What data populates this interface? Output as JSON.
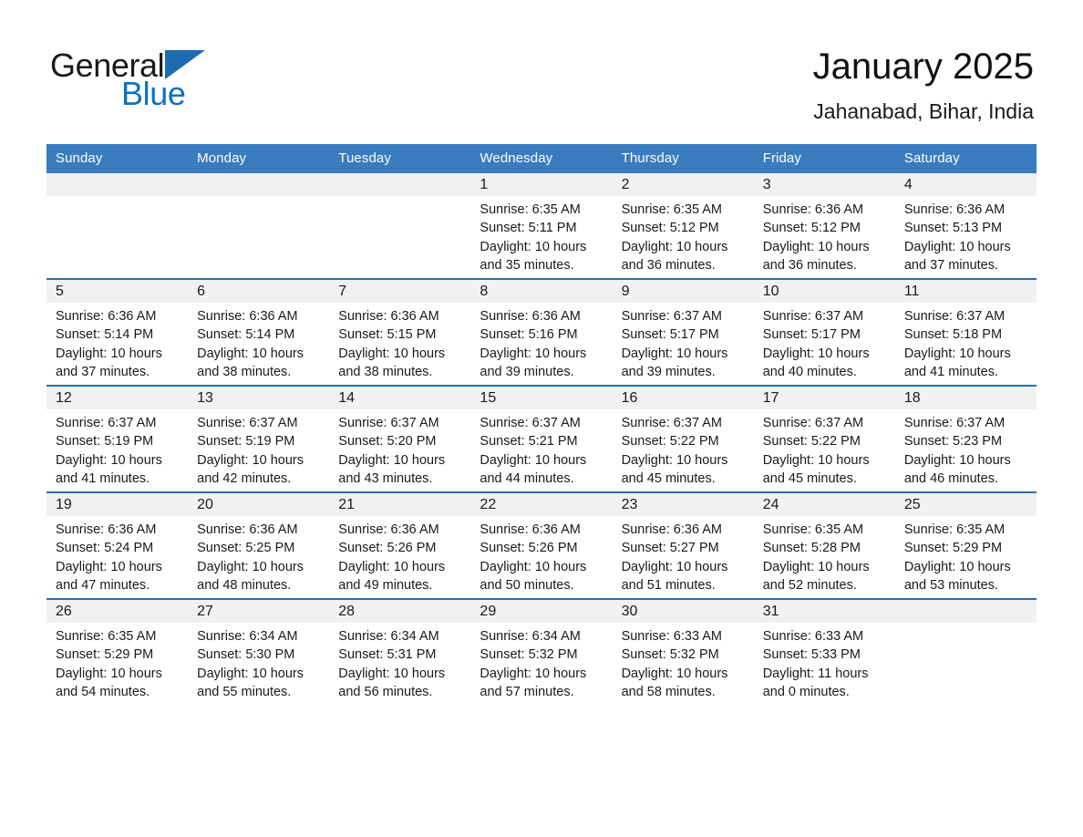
{
  "brand": {
    "name_part1": "General",
    "name_part2": "Blue",
    "triangle_color": "#1b6cb3",
    "blue_text_color": "#0d72c4"
  },
  "header": {
    "title": "January 2025",
    "subtitle": "Jahanabad, Bihar, India"
  },
  "theme": {
    "header_row_bg": "#3A7CBE",
    "week_divider": "#2E6DA4",
    "daynum_band_bg": "#F1F1F1"
  },
  "weekday_headers": [
    "Sunday",
    "Monday",
    "Tuesday",
    "Wednesday",
    "Thursday",
    "Friday",
    "Saturday"
  ],
  "weeks": [
    [
      {
        "day": "",
        "blank": true,
        "sunrise": "",
        "sunset": "",
        "daylight_1": "",
        "daylight_2": ""
      },
      {
        "day": "",
        "blank": true,
        "sunrise": "",
        "sunset": "",
        "daylight_1": "",
        "daylight_2": ""
      },
      {
        "day": "",
        "blank": true,
        "sunrise": "",
        "sunset": "",
        "daylight_1": "",
        "daylight_2": ""
      },
      {
        "day": "1",
        "blank": false,
        "sunrise": "Sunrise: 6:35 AM",
        "sunset": "Sunset: 5:11 PM",
        "daylight_1": "Daylight: 10 hours",
        "daylight_2": "and 35 minutes."
      },
      {
        "day": "2",
        "blank": false,
        "sunrise": "Sunrise: 6:35 AM",
        "sunset": "Sunset: 5:12 PM",
        "daylight_1": "Daylight: 10 hours",
        "daylight_2": "and 36 minutes."
      },
      {
        "day": "3",
        "blank": false,
        "sunrise": "Sunrise: 6:36 AM",
        "sunset": "Sunset: 5:12 PM",
        "daylight_1": "Daylight: 10 hours",
        "daylight_2": "and 36 minutes."
      },
      {
        "day": "4",
        "blank": false,
        "sunrise": "Sunrise: 6:36 AM",
        "sunset": "Sunset: 5:13 PM",
        "daylight_1": "Daylight: 10 hours",
        "daylight_2": "and 37 minutes."
      }
    ],
    [
      {
        "day": "5",
        "blank": false,
        "sunrise": "Sunrise: 6:36 AM",
        "sunset": "Sunset: 5:14 PM",
        "daylight_1": "Daylight: 10 hours",
        "daylight_2": "and 37 minutes."
      },
      {
        "day": "6",
        "blank": false,
        "sunrise": "Sunrise: 6:36 AM",
        "sunset": "Sunset: 5:14 PM",
        "daylight_1": "Daylight: 10 hours",
        "daylight_2": "and 38 minutes."
      },
      {
        "day": "7",
        "blank": false,
        "sunrise": "Sunrise: 6:36 AM",
        "sunset": "Sunset: 5:15 PM",
        "daylight_1": "Daylight: 10 hours",
        "daylight_2": "and 38 minutes."
      },
      {
        "day": "8",
        "blank": false,
        "sunrise": "Sunrise: 6:36 AM",
        "sunset": "Sunset: 5:16 PM",
        "daylight_1": "Daylight: 10 hours",
        "daylight_2": "and 39 minutes."
      },
      {
        "day": "9",
        "blank": false,
        "sunrise": "Sunrise: 6:37 AM",
        "sunset": "Sunset: 5:17 PM",
        "daylight_1": "Daylight: 10 hours",
        "daylight_2": "and 39 minutes."
      },
      {
        "day": "10",
        "blank": false,
        "sunrise": "Sunrise: 6:37 AM",
        "sunset": "Sunset: 5:17 PM",
        "daylight_1": "Daylight: 10 hours",
        "daylight_2": "and 40 minutes."
      },
      {
        "day": "11",
        "blank": false,
        "sunrise": "Sunrise: 6:37 AM",
        "sunset": "Sunset: 5:18 PM",
        "daylight_1": "Daylight: 10 hours",
        "daylight_2": "and 41 minutes."
      }
    ],
    [
      {
        "day": "12",
        "blank": false,
        "sunrise": "Sunrise: 6:37 AM",
        "sunset": "Sunset: 5:19 PM",
        "daylight_1": "Daylight: 10 hours",
        "daylight_2": "and 41 minutes."
      },
      {
        "day": "13",
        "blank": false,
        "sunrise": "Sunrise: 6:37 AM",
        "sunset": "Sunset: 5:19 PM",
        "daylight_1": "Daylight: 10 hours",
        "daylight_2": "and 42 minutes."
      },
      {
        "day": "14",
        "blank": false,
        "sunrise": "Sunrise: 6:37 AM",
        "sunset": "Sunset: 5:20 PM",
        "daylight_1": "Daylight: 10 hours",
        "daylight_2": "and 43 minutes."
      },
      {
        "day": "15",
        "blank": false,
        "sunrise": "Sunrise: 6:37 AM",
        "sunset": "Sunset: 5:21 PM",
        "daylight_1": "Daylight: 10 hours",
        "daylight_2": "and 44 minutes."
      },
      {
        "day": "16",
        "blank": false,
        "sunrise": "Sunrise: 6:37 AM",
        "sunset": "Sunset: 5:22 PM",
        "daylight_1": "Daylight: 10 hours",
        "daylight_2": "and 45 minutes."
      },
      {
        "day": "17",
        "blank": false,
        "sunrise": "Sunrise: 6:37 AM",
        "sunset": "Sunset: 5:22 PM",
        "daylight_1": "Daylight: 10 hours",
        "daylight_2": "and 45 minutes."
      },
      {
        "day": "18",
        "blank": false,
        "sunrise": "Sunrise: 6:37 AM",
        "sunset": "Sunset: 5:23 PM",
        "daylight_1": "Daylight: 10 hours",
        "daylight_2": "and 46 minutes."
      }
    ],
    [
      {
        "day": "19",
        "blank": false,
        "sunrise": "Sunrise: 6:36 AM",
        "sunset": "Sunset: 5:24 PM",
        "daylight_1": "Daylight: 10 hours",
        "daylight_2": "and 47 minutes."
      },
      {
        "day": "20",
        "blank": false,
        "sunrise": "Sunrise: 6:36 AM",
        "sunset": "Sunset: 5:25 PM",
        "daylight_1": "Daylight: 10 hours",
        "daylight_2": "and 48 minutes."
      },
      {
        "day": "21",
        "blank": false,
        "sunrise": "Sunrise: 6:36 AM",
        "sunset": "Sunset: 5:26 PM",
        "daylight_1": "Daylight: 10 hours",
        "daylight_2": "and 49 minutes."
      },
      {
        "day": "22",
        "blank": false,
        "sunrise": "Sunrise: 6:36 AM",
        "sunset": "Sunset: 5:26 PM",
        "daylight_1": "Daylight: 10 hours",
        "daylight_2": "and 50 minutes."
      },
      {
        "day": "23",
        "blank": false,
        "sunrise": "Sunrise: 6:36 AM",
        "sunset": "Sunset: 5:27 PM",
        "daylight_1": "Daylight: 10 hours",
        "daylight_2": "and 51 minutes."
      },
      {
        "day": "24",
        "blank": false,
        "sunrise": "Sunrise: 6:35 AM",
        "sunset": "Sunset: 5:28 PM",
        "daylight_1": "Daylight: 10 hours",
        "daylight_2": "and 52 minutes."
      },
      {
        "day": "25",
        "blank": false,
        "sunrise": "Sunrise: 6:35 AM",
        "sunset": "Sunset: 5:29 PM",
        "daylight_1": "Daylight: 10 hours",
        "daylight_2": "and 53 minutes."
      }
    ],
    [
      {
        "day": "26",
        "blank": false,
        "sunrise": "Sunrise: 6:35 AM",
        "sunset": "Sunset: 5:29 PM",
        "daylight_1": "Daylight: 10 hours",
        "daylight_2": "and 54 minutes."
      },
      {
        "day": "27",
        "blank": false,
        "sunrise": "Sunrise: 6:34 AM",
        "sunset": "Sunset: 5:30 PM",
        "daylight_1": "Daylight: 10 hours",
        "daylight_2": "and 55 minutes."
      },
      {
        "day": "28",
        "blank": false,
        "sunrise": "Sunrise: 6:34 AM",
        "sunset": "Sunset: 5:31 PM",
        "daylight_1": "Daylight: 10 hours",
        "daylight_2": "and 56 minutes."
      },
      {
        "day": "29",
        "blank": false,
        "sunrise": "Sunrise: 6:34 AM",
        "sunset": "Sunset: 5:32 PM",
        "daylight_1": "Daylight: 10 hours",
        "daylight_2": "and 57 minutes."
      },
      {
        "day": "30",
        "blank": false,
        "sunrise": "Sunrise: 6:33 AM",
        "sunset": "Sunset: 5:32 PM",
        "daylight_1": "Daylight: 10 hours",
        "daylight_2": "and 58 minutes."
      },
      {
        "day": "31",
        "blank": false,
        "sunrise": "Sunrise: 6:33 AM",
        "sunset": "Sunset: 5:33 PM",
        "daylight_1": "Daylight: 11 hours",
        "daylight_2": "and 0 minutes."
      },
      {
        "day": "",
        "blank": true,
        "sunrise": "",
        "sunset": "",
        "daylight_1": "",
        "daylight_2": ""
      }
    ]
  ]
}
